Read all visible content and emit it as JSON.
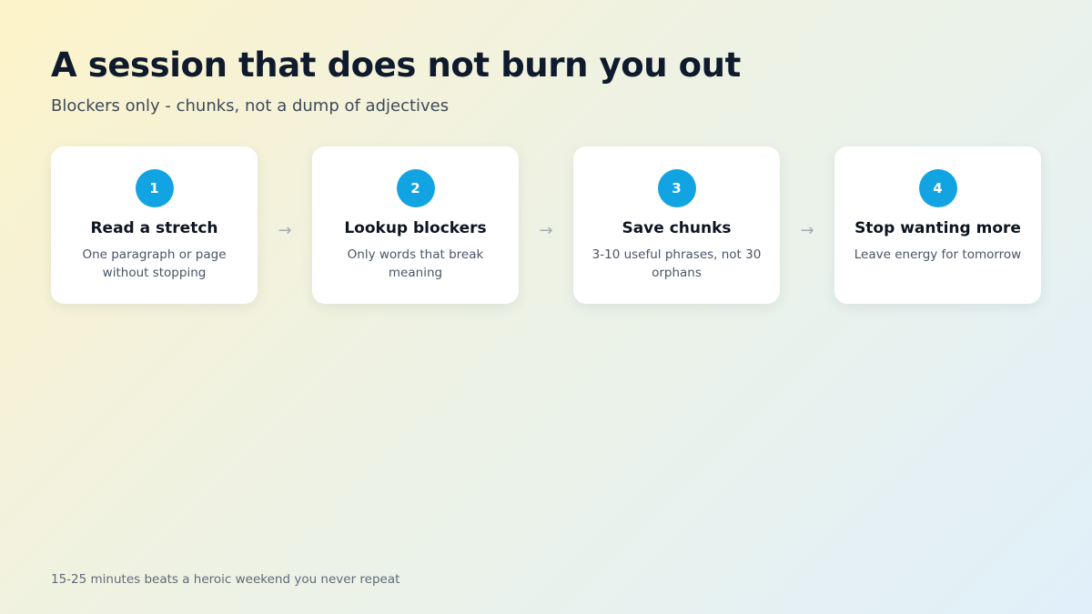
{
  "title": "A session that does not burn you out",
  "subtitle": "Blockers only - chunks, not a dump of adjectives",
  "steps": [
    {
      "number": "1",
      "title": "Read a stretch",
      "description": "One paragraph or page without stopping"
    },
    {
      "number": "2",
      "title": "Lookup blockers",
      "description": "Only words that break meaning"
    },
    {
      "number": "3",
      "title": "Save chunks",
      "description": "3-10 useful phrases, not 30 orphans"
    },
    {
      "number": "4",
      "title": "Stop wanting more",
      "description": "Leave energy for tomorrow"
    }
  ],
  "arrow_glyph": "→",
  "footer": "15-25 minutes beats a heroic weekend you never repeat",
  "colors": {
    "accent": "#12a3e3",
    "title": "#0f1b2d",
    "card_background": "#ffffff"
  }
}
